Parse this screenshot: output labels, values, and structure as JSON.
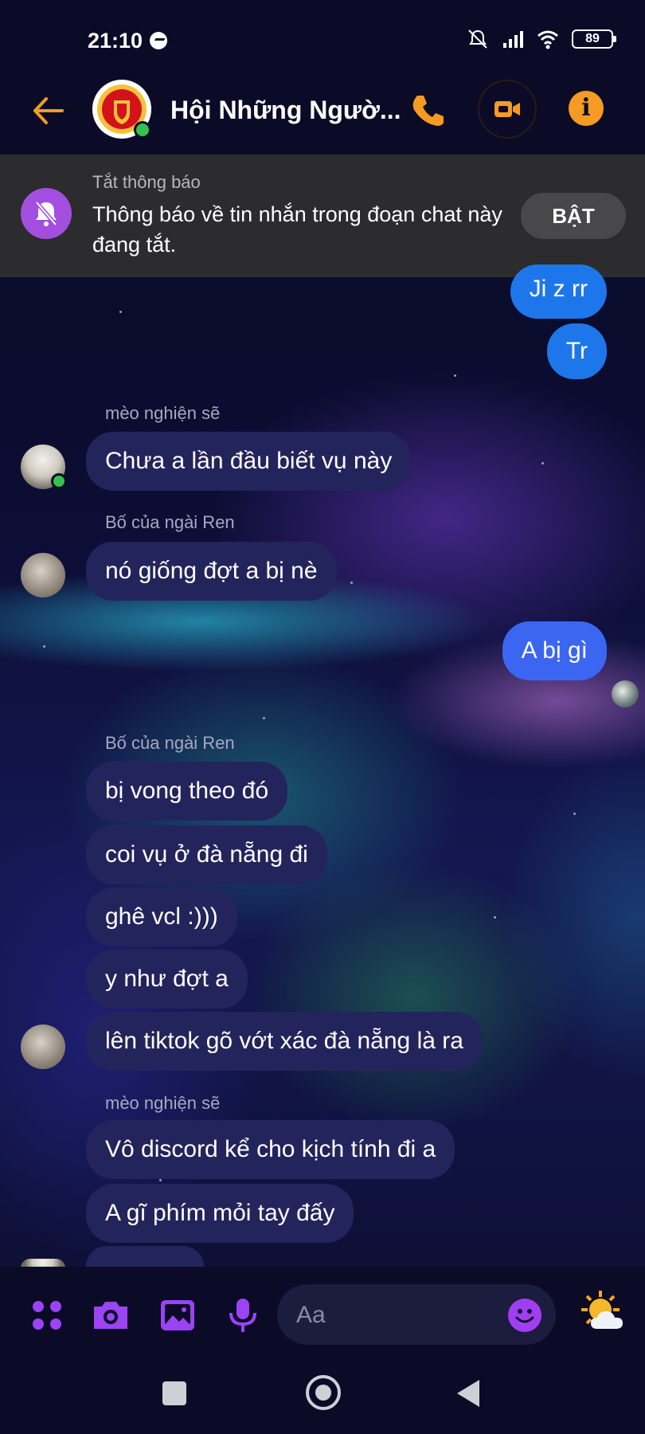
{
  "status_bar": {
    "time": "21:10",
    "battery": "89"
  },
  "header": {
    "title": "Hội Những Ngườ...",
    "icons": [
      "back-arrow-icon",
      "phone-icon",
      "video-camera-icon",
      "info-icon"
    ],
    "accent_color": "#f59a23"
  },
  "banner": {
    "label": "Tắt thông báo",
    "text": "Thông báo về tin nhắn trong đoạn chat này đang tắt.",
    "button": "BẬT"
  },
  "messages": [
    {
      "direction": "out",
      "text": "Ji z rr"
    },
    {
      "direction": "out",
      "text": "Tr"
    },
    {
      "direction": "in",
      "sender": "mèo nghiện sẽ",
      "text": "Chưa a lần đầu biết vụ này"
    },
    {
      "direction": "in",
      "sender": "Bố của ngài Ren",
      "text": "nó giống đợt a bị nè"
    },
    {
      "direction": "out",
      "text": "A bị gì"
    },
    {
      "direction": "in",
      "sender": "Bố của ngài Ren",
      "text": "bị vong theo đó"
    },
    {
      "direction": "in",
      "text": "coi vụ ở đà nẵng đi"
    },
    {
      "direction": "in",
      "text": "ghê vcl :)))"
    },
    {
      "direction": "in",
      "text": "y như đợt a"
    },
    {
      "direction": "in",
      "text": "lên tiktok gõ vớt xác đà nẵng là ra"
    },
    {
      "direction": "in",
      "sender": "mèo nghiện sẽ",
      "text": "Vô discord kể cho kịch tính đi a"
    },
    {
      "direction": "in",
      "text": "A gĩ phím mỏi tay đấy"
    }
  ],
  "composer": {
    "placeholder": "Aa",
    "icons": [
      "menu-dots-icon",
      "camera-icon",
      "image-icon",
      "microphone-icon",
      "emoji-icon",
      "weather-sun-cloud-icon"
    ],
    "accent_color": "#9b43f5"
  },
  "navigation": {
    "icons": [
      "recent-apps-icon",
      "home-icon",
      "back-icon"
    ]
  },
  "colors": {
    "outgoing_bubble": "#1e77ea",
    "incoming_bubble": "#24245c",
    "banner_bg": "#2c2c2e"
  }
}
